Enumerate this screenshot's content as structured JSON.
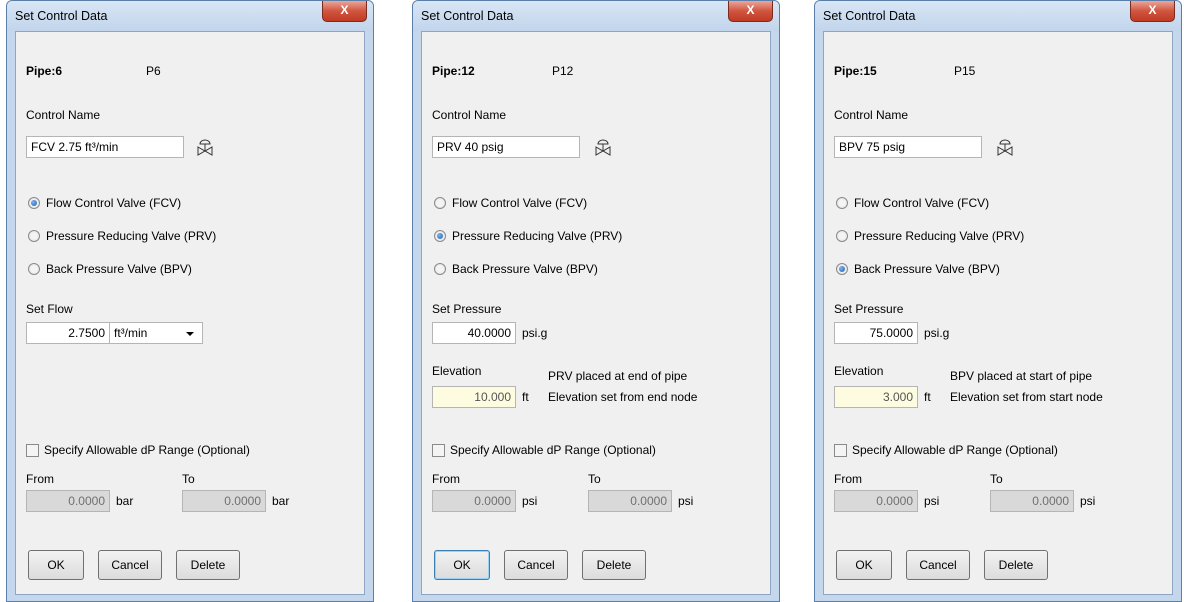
{
  "dialogs": [
    {
      "title": "Set Control Data",
      "close_label": "X",
      "pipe_label": "Pipe:6",
      "pipe_name": "P6",
      "control_name_label": "Control Name",
      "control_name_value": "FCV 2.75 ft³/min",
      "radio_fcv": "Flow Control Valve (FCV)",
      "radio_prv": "Pressure Reducing Valve (PRV)",
      "radio_bpv": "Back Pressure Valve (BPV)",
      "selected": "fcv",
      "set_label": "Set Flow",
      "set_value": "2.7500",
      "set_unit": "ft³/min",
      "specify_label": "Specify Allowable dP Range (Optional)",
      "specify_checked": false,
      "from_label": "From",
      "to_label": "To",
      "from_value": "0.0000",
      "to_value": "0.0000",
      "range_unit": "bar",
      "ok_label": "OK",
      "cancel_label": "Cancel",
      "delete_label": "Delete"
    },
    {
      "title": "Set Control Data",
      "close_label": "X",
      "pipe_label": "Pipe:12",
      "pipe_name": "P12",
      "control_name_label": "Control Name",
      "control_name_value": "PRV 40 psig",
      "radio_fcv": "Flow Control Valve (FCV)",
      "radio_prv": "Pressure Reducing Valve (PRV)",
      "radio_bpv": "Back Pressure Valve (BPV)",
      "selected": "prv",
      "set_label": "Set Pressure",
      "set_value": "40.0000",
      "set_unit": "psi.g",
      "elevation_label": "Elevation",
      "elevation_value": "10.000",
      "elevation_unit": "ft",
      "note_line1": "PRV placed at end of pipe",
      "note_line2": "Elevation set from end node",
      "specify_label": "Specify Allowable dP Range (Optional)",
      "specify_checked": false,
      "from_label": "From",
      "to_label": "To",
      "from_value": "0.0000",
      "to_value": "0.0000",
      "range_unit": "psi",
      "ok_label": "OK",
      "cancel_label": "Cancel",
      "delete_label": "Delete"
    },
    {
      "title": "Set Control Data",
      "close_label": "X",
      "pipe_label": "Pipe:15",
      "pipe_name": "P15",
      "control_name_label": "Control Name",
      "control_name_value": "BPV 75 psig",
      "radio_fcv": "Flow Control Valve (FCV)",
      "radio_prv": "Pressure Reducing Valve (PRV)",
      "radio_bpv": "Back Pressure Valve (BPV)",
      "selected": "bpv",
      "set_label": "Set Pressure",
      "set_value": "75.0000",
      "set_unit": "psi.g",
      "elevation_label": "Elevation",
      "elevation_value": "3.000",
      "elevation_unit": "ft",
      "note_line1": "BPV placed at start of pipe",
      "note_line2": "Elevation set from start node",
      "specify_label": "Specify Allowable dP Range (Optional)",
      "specify_checked": false,
      "from_label": "From",
      "to_label": "To",
      "from_value": "0.0000",
      "to_value": "0.0000",
      "range_unit": "psi",
      "ok_label": "OK",
      "cancel_label": "Cancel",
      "delete_label": "Delete"
    }
  ]
}
